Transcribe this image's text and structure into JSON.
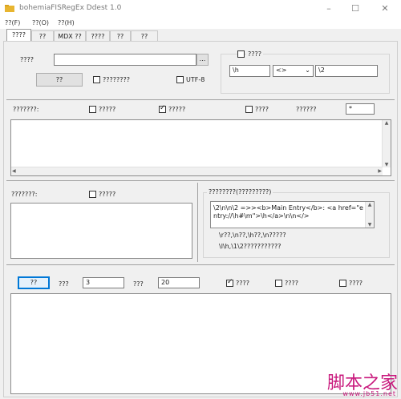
{
  "window": {
    "title": "bohemiaFISRegEx Ddest 1.0",
    "minimize": "–",
    "maximize": "☐",
    "close": "✕"
  },
  "menu": [
    "??(F)",
    "??(O)",
    "??(H)"
  ],
  "tabs": [
    "????",
    "??",
    "MDX ??",
    "????",
    "??",
    "??"
  ],
  "top": {
    "source_label": "????",
    "source_value": "",
    "browse_label": "...",
    "run_button": "??",
    "option_check": "????????",
    "utf8_check": "UTF-8",
    "replace_group_check": "????",
    "replace_from": "\\h",
    "replace_op": "<>",
    "replace_to": "\\2"
  },
  "section1": {
    "label": "???????:",
    "check1": "?????",
    "check2": "?????",
    "check3": "????",
    "count_label": "??????",
    "count_value": "*"
  },
  "section2": {
    "label": "???????:",
    "check": "?????"
  },
  "samples": {
    "title": "????????(?????????)",
    "box_text": "\\2\\n\\n\\2 =>><b>Main Entry</b>: <a href=\"entry://\\h#\\m\">\\h</a>\\n\\n</>",
    "line1": "\\r??,\\n??,\\h??,\\n?????",
    "line2": "\\l\\h,\\1\\2???????????"
  },
  "bottom": {
    "run_button": "??",
    "label1": "???",
    "value1": "3",
    "label2": "???",
    "value2": "20",
    "check1": "????",
    "check2": "????",
    "check3": "????"
  },
  "watermark": {
    "text": "脚本之家",
    "site": "www.jb51.net"
  }
}
